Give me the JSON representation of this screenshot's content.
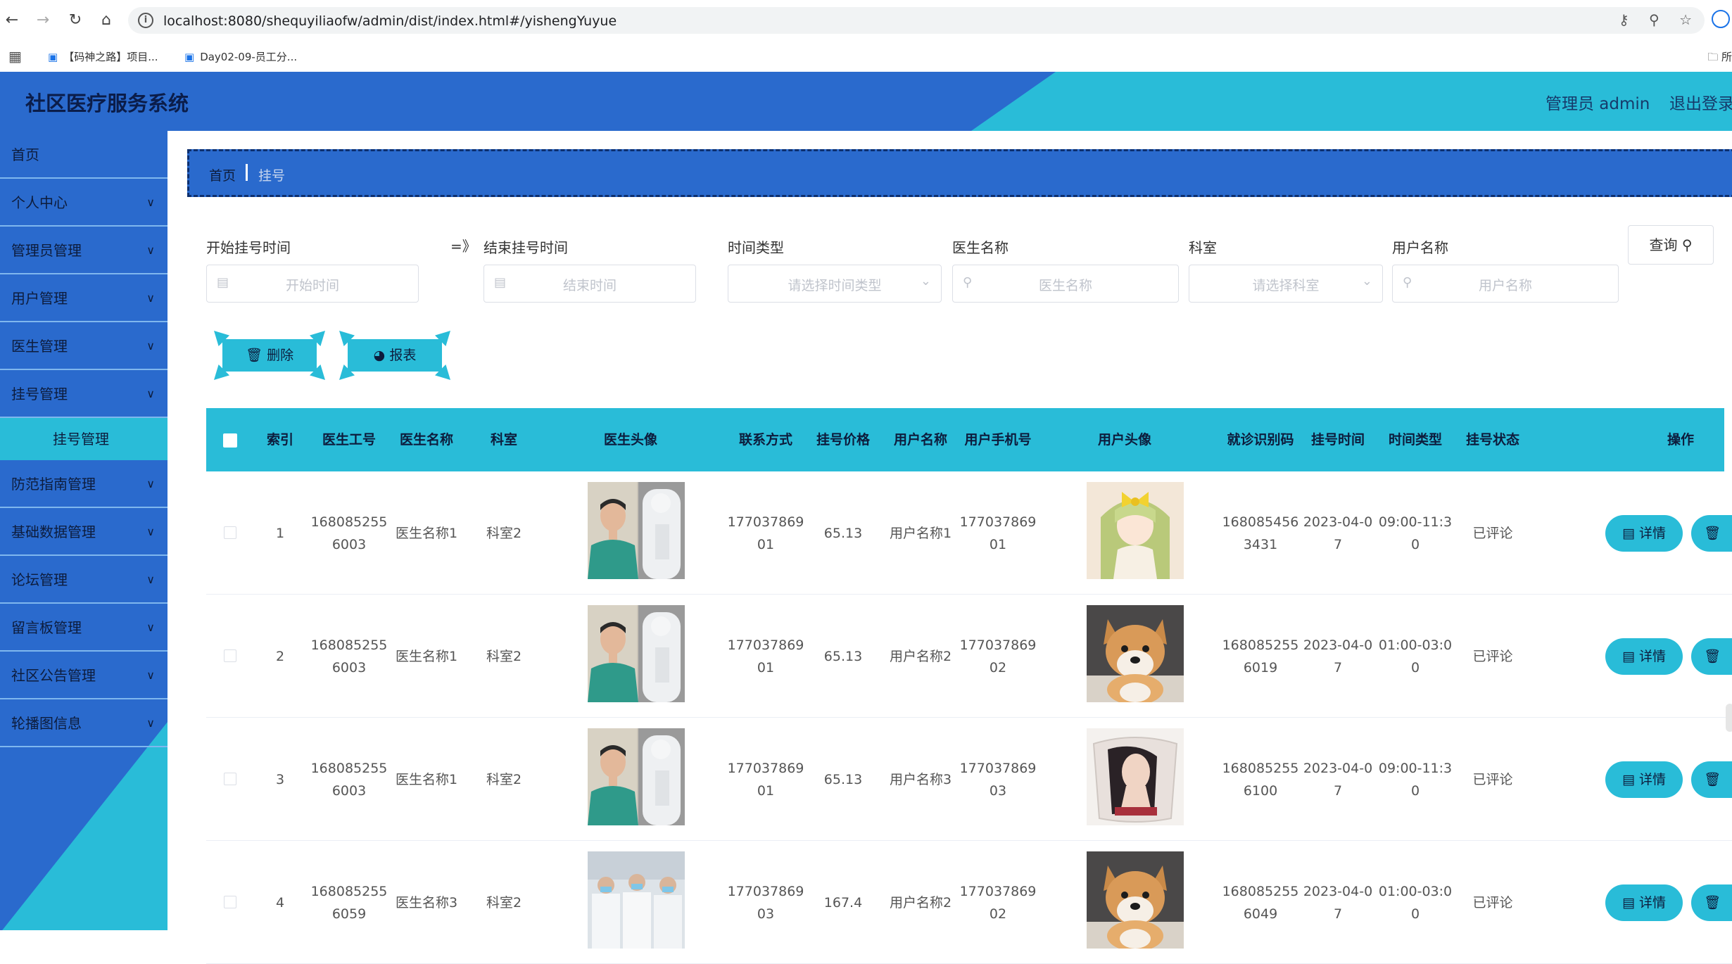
{
  "browser": {
    "url": "localhost:8080/shequyiliaofw/admin/dist/index.html#/yishengYuyue",
    "bookmarks": [
      "【码神之路】项目...",
      "Day02-09-员工分..."
    ],
    "bookmarks_right": "所"
  },
  "header": {
    "title": "社区医疗服务系统",
    "user": "管理员 admin",
    "logout": "退出登录"
  },
  "sidebar": {
    "items": [
      {
        "label": "首页",
        "chevron": false
      },
      {
        "label": "个人中心",
        "chevron": true
      },
      {
        "label": "管理员管理",
        "chevron": true
      },
      {
        "label": "用户管理",
        "chevron": true
      },
      {
        "label": "医生管理",
        "chevron": true
      },
      {
        "label": "挂号管理",
        "chevron": true
      },
      {
        "label": "防范指南管理",
        "chevron": true
      },
      {
        "label": "基础数据管理",
        "chevron": true
      },
      {
        "label": "论坛管理",
        "chevron": true
      },
      {
        "label": "留言板管理",
        "chevron": true
      },
      {
        "label": "社区公告管理",
        "chevron": true
      },
      {
        "label": "轮播图信息",
        "chevron": true
      }
    ],
    "submenu_active": "挂号管理"
  },
  "breadcrumb": {
    "home": "首页",
    "current": "挂号"
  },
  "search": {
    "start_label": "开始挂号时间",
    "start_placeholder": "开始时间",
    "range_separator": "=》",
    "end_label": "结束挂号时间",
    "end_placeholder": "结束时间",
    "time_type_label": "时间类型",
    "time_type_placeholder": "请选择时间类型",
    "doctor_label": "医生名称",
    "doctor_placeholder": "医生名称",
    "dept_label": "科室",
    "dept_placeholder": "请选择科室",
    "user_label": "用户名称",
    "user_placeholder": "用户名称",
    "query_button": "查询"
  },
  "actions": {
    "delete": "删除",
    "report": "报表"
  },
  "table": {
    "headers": {
      "index": "索引",
      "doctor_id": "医生工号",
      "doctor_name": "医生名称",
      "dept": "科室",
      "doctor_avatar": "医生头像",
      "contact": "联系方式",
      "price": "挂号价格",
      "user_name": "用户名称",
      "user_phone": "用户手机号",
      "user_avatar": "用户头像",
      "visit_code": "就诊识别码",
      "reg_time": "挂号时间",
      "time_type": "时间类型",
      "status": "挂号状态",
      "ops": "操作"
    },
    "detail_button": "详情",
    "rows": [
      {
        "index": "1",
        "doctor_id": "1680852556003",
        "doctor_name": "医生名称1",
        "dept": "科室2",
        "contact": "17703786901",
        "price": "65.13",
        "user_name": "用户名称1",
        "user_phone": "17703786901",
        "visit_code": "1680854563431",
        "reg_time": "2023-04-07",
        "time_type": "09:00-11:30",
        "status": "已评论",
        "doctor_avatar": "doctor-a",
        "user_avatar": "anime"
      },
      {
        "index": "2",
        "doctor_id": "1680852556003",
        "doctor_name": "医生名称1",
        "dept": "科室2",
        "contact": "17703786901",
        "price": "65.13",
        "user_name": "用户名称2",
        "user_phone": "17703786902",
        "visit_code": "1680852556019",
        "reg_time": "2023-04-07",
        "time_type": "01:00-03:00",
        "status": "已评论",
        "doctor_avatar": "doctor-a",
        "user_avatar": "dog"
      },
      {
        "index": "3",
        "doctor_id": "1680852556003",
        "doctor_name": "医生名称1",
        "dept": "科室2",
        "contact": "17703786901",
        "price": "65.13",
        "user_name": "用户名称3",
        "user_phone": "17703786903",
        "visit_code": "1680852556100",
        "reg_time": "2023-04-07",
        "time_type": "09:00-11:30",
        "status": "已评论",
        "doctor_avatar": "doctor-a",
        "user_avatar": "woman"
      },
      {
        "index": "4",
        "doctor_id": "1680852556059",
        "doctor_name": "医生名称3",
        "dept": "科室2",
        "contact": "17703786903",
        "price": "167.4",
        "user_name": "用户名称2",
        "user_phone": "17703786902",
        "visit_code": "1680852556049",
        "reg_time": "2023-04-07",
        "time_type": "01:00-03:00",
        "status": "已评论",
        "doctor_avatar": "doctor-b",
        "user_avatar": "dog"
      }
    ]
  },
  "colors": {
    "primary": "#2a6acd",
    "accent": "#29bcd8",
    "dark_text": "#0d1c3c"
  }
}
